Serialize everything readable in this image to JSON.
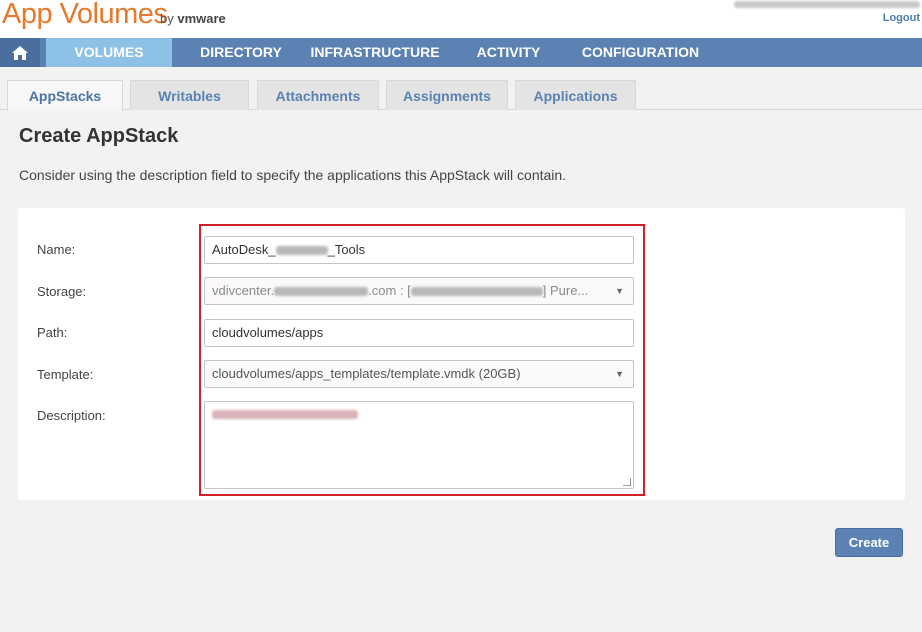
{
  "header": {
    "logo_text": "App Volumes",
    "logo_by": "by",
    "logo_vendor": "vmware",
    "logout_label": "Logout"
  },
  "nav": {
    "home_icon": "home-icon",
    "items": [
      {
        "label": "VOLUMES",
        "active": true
      },
      {
        "label": "DIRECTORY",
        "active": false
      },
      {
        "label": "INFRASTRUCTURE",
        "active": false
      },
      {
        "label": "ACTIVITY",
        "active": false
      },
      {
        "label": "CONFIGURATION",
        "active": false
      }
    ]
  },
  "tabs": [
    {
      "label": "AppStacks",
      "active": true
    },
    {
      "label": "Writables",
      "active": false
    },
    {
      "label": "Attachments",
      "active": false
    },
    {
      "label": "Assignments",
      "active": false
    },
    {
      "label": "Applications",
      "active": false
    }
  ],
  "page": {
    "title": "Create AppStack",
    "description": "Consider using the description field to specify the applications this AppStack will contain."
  },
  "form": {
    "name": {
      "label": "Name:",
      "value_prefix": "AutoDesk_",
      "value_suffix": "_Tools"
    },
    "storage": {
      "label": "Storage:",
      "value_prefix": "vdivcenter.",
      "value_middle": ".com : [",
      "value_suffix": "] Pure..."
    },
    "path": {
      "label": "Path:",
      "value": "cloudvolumes/apps"
    },
    "template": {
      "label": "Template:",
      "value": "cloudvolumes/apps_templates/template.vmdk (20GB)"
    },
    "description": {
      "label": "Description:"
    }
  },
  "actions": {
    "create_label": "Create"
  },
  "colors": {
    "nav_bg": "#5b82b3",
    "nav_active": "#8ec1e6",
    "highlight_border": "#d0202a",
    "logo": "#e8792b"
  }
}
